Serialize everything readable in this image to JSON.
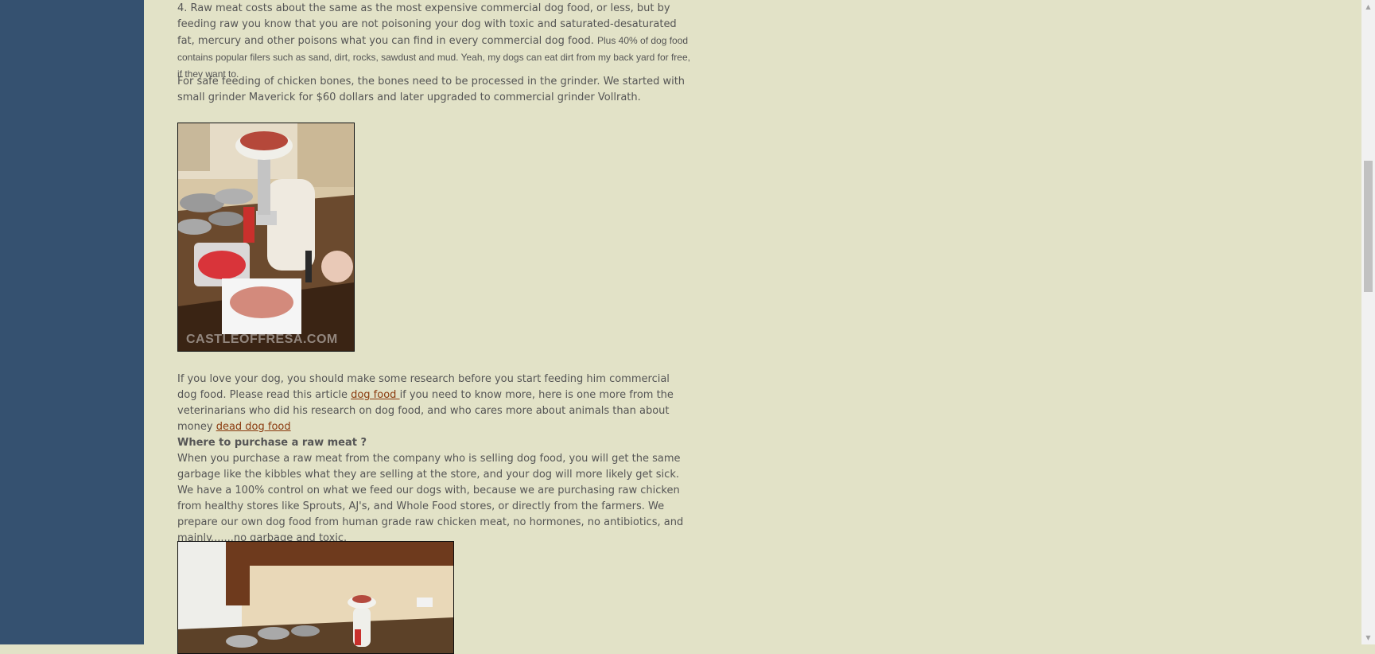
{
  "article": {
    "p1_main": "4. Raw meat costs about the same as the most expensive commercial dog food, or less, but by feeding raw you know that you are not poisoning your dog with toxic and saturated-desaturated fat, mercury and other poisons what you can find in every commercial dog food. ",
    "p1_small": "Plus 40% of dog food contains popular filers such as sand, dirt, rocks, sawdust and mud. Yeah, my dogs can eat dirt from my back yard for free, if they want to.",
    "p2": "For safe feeding of chicken bones, the bones need to be processed in the grinder. We started with small grinder Maverick for $60 dollars and later upgraded to commercial grinder Vollrath.",
    "photo1_watermark": "CASTLEOFFRESA.COM",
    "p3_before": "If you love your dog, you should make some research before you start feeding him commercial dog food. Please read this article ",
    "p3_link1": "dog food ",
    "p3_middle": "if you need to know more, here is one more from the veterinarians who did his research on dog food, and who cares more about animals than about money ",
    "p3_link2": "dead dog food",
    "heading_where": "Where to purchase a raw meat ?",
    "p4": "When you purchase a raw meat from the company who is selling dog food, you will get the same garbage like the kibbles what they are selling at the store, and your dog will more likely get sick. We have a 100% control on what we feed our dogs with, because we are purchasing raw chicken from healthy stores like Sprouts, AJ's, and Whole Food stores, or directly from the farmers. We prepare our own dog food from human grade raw chicken meat, no hormones, no antibiotics, and mainly.......no garbage and toxic."
  },
  "scrollbar": {
    "up_icon": "▲",
    "down_icon": "▼"
  },
  "colors": {
    "sidebar": "#355170",
    "page_bg": "#e2e2c7",
    "text": "#555555",
    "link": "#8a3a0e"
  }
}
